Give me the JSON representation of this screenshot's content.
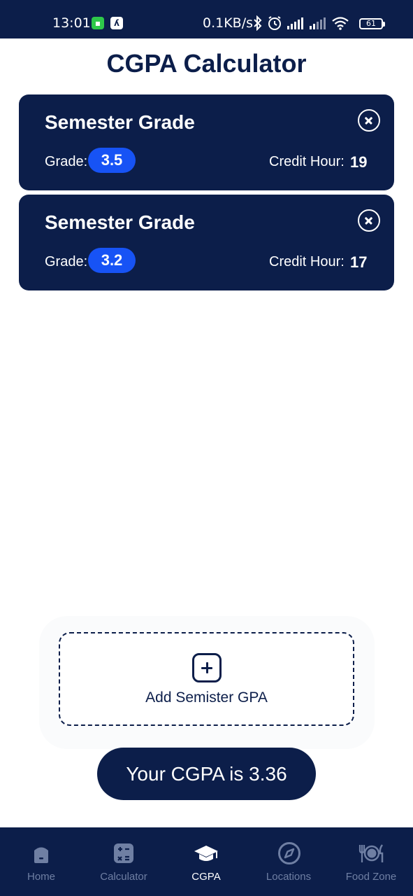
{
  "status_bar": {
    "time": "13:01",
    "network_speed": "0.1KB/s",
    "battery": "61",
    "icons": [
      "app-icon-green",
      "app-icon-white",
      "bluetooth-icon",
      "alarm-icon",
      "signal-icon",
      "signal-icon",
      "wifi-icon",
      "battery-icon"
    ]
  },
  "page": {
    "title": "CGPA Calculator"
  },
  "semesters": [
    {
      "title": "Semester Grade",
      "grade_label": "Grade:",
      "grade": "3.5",
      "credit_label": "Credit Hour:",
      "credit_hours": "19"
    },
    {
      "title": "Semester Grade",
      "grade_label": "Grade:",
      "grade": "3.2",
      "credit_label": "Credit Hour:",
      "credit_hours": "17"
    }
  ],
  "add_button": {
    "label": "Add Semister GPA",
    "icon": "add-square-icon"
  },
  "result": {
    "label": "Your CGPA is 3.36"
  },
  "nav": {
    "items": [
      {
        "label": "Home",
        "icon": "home-icon",
        "active": false
      },
      {
        "label": "Calculator",
        "icon": "calculator-icon",
        "active": false
      },
      {
        "label": "CGPA",
        "icon": "graduation-cap-icon",
        "active": true
      },
      {
        "label": "Locations",
        "icon": "compass-icon",
        "active": false
      },
      {
        "label": "Food Zone",
        "icon": "dining-icon",
        "active": false
      }
    ]
  },
  "colors": {
    "primary": "#0c1e4a",
    "accent": "#1753f5",
    "nav_inactive": "#6f7fa3",
    "background": "#ffffff"
  }
}
